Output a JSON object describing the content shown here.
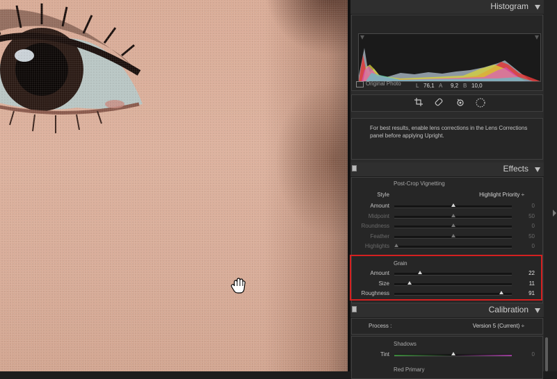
{
  "histogram": {
    "title": "Histogram",
    "readout": {
      "l_label": "L",
      "l_value": "76,1",
      "a_label": "A",
      "a_value": "9,2",
      "b_label": "B",
      "b_value": "10,0"
    },
    "original_photo_label": "Original Photo"
  },
  "tools": {
    "icons": [
      "crop-icon",
      "healing-brush-icon",
      "red-eye-icon",
      "masking-icon"
    ]
  },
  "upright_note": "For best results, enable lens corrections in the Lens Corrections panel before applying Upright.",
  "effects": {
    "title": "Effects",
    "vignette": {
      "heading": "Post-Crop Vignetting",
      "style_label": "Style",
      "style_value": "Highlight Priority ÷",
      "sliders": [
        {
          "label": "Amount",
          "value": "0",
          "pos": 0.5
        },
        {
          "label": "Midpoint",
          "value": "50",
          "pos": 0.5
        },
        {
          "label": "Roundness",
          "value": "0",
          "pos": 0.5
        },
        {
          "label": "Feather",
          "value": "50",
          "pos": 0.5
        },
        {
          "label": "Highlights",
          "value": "0",
          "pos": 0.02
        }
      ]
    },
    "grain": {
      "heading": "Grain",
      "sliders": [
        {
          "label": "Amount",
          "value": "22",
          "pos": 0.22
        },
        {
          "label": "Size",
          "value": "11",
          "pos": 0.13
        },
        {
          "label": "Roughness",
          "value": "91",
          "pos": 0.91
        }
      ]
    }
  },
  "calibration": {
    "title": "Calibration",
    "process_label": "Process :",
    "process_value": "Version 5 (Current) ÷",
    "shadows_heading": "Shadows",
    "tint_label": "Tint",
    "tint_value": "0",
    "tint_pos": 0.5,
    "red_primary_heading": "Red Primary"
  },
  "colors": {
    "accent_highlight": "#d42020",
    "panel_bg": "#2b2b2b"
  }
}
